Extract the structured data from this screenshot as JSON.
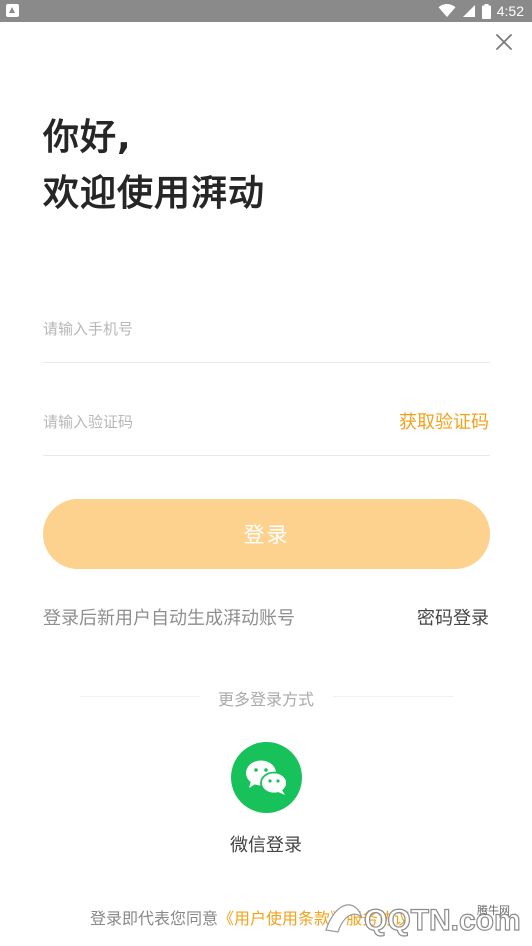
{
  "status_bar": {
    "time": "4:52",
    "icons": [
      "notification-icon",
      "wifi-icon",
      "signal-icon",
      "battery-icon"
    ],
    "background": "#8a8a8a"
  },
  "close_icon": "close-icon",
  "greeting": {
    "line1": "你好,",
    "line2": "欢迎使用湃动"
  },
  "form": {
    "phone_placeholder": "请输入手机号",
    "code_placeholder": "请输入验证码",
    "get_code_label": "获取验证码",
    "login_label": "登录"
  },
  "hint_text": "登录后新用户自动生成湃动账号",
  "password_login_label": "密码登录",
  "more_login_label": "更多登录方式",
  "wechat": {
    "icon": "wechat-icon",
    "label": "微信登录"
  },
  "agreement": {
    "prefix": "登录即代表您同意",
    "link": "《用户使用条款》服务协议"
  },
  "watermark": {
    "text": "QQTN.com",
    "cn": "腾牛网"
  },
  "colors": {
    "accent": "#f3a21b",
    "login_button": "#fdd28e",
    "wechat": "#17c25a"
  }
}
